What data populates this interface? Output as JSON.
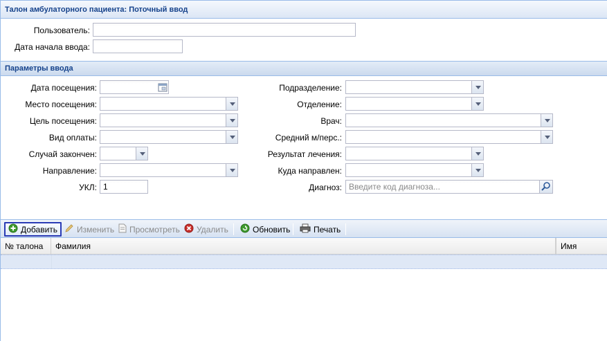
{
  "window": {
    "title": "Талон амбулаторного пациента: Поточный ввод"
  },
  "top_form": {
    "user_label": "Пользователь:",
    "user_value": "",
    "start_date_label": "Дата начала ввода:",
    "start_date_value": ""
  },
  "params": {
    "section_title": "Параметры ввода",
    "visit_date_label": "Дата посещения:",
    "visit_place_label": "Место посещения:",
    "visit_goal_label": "Цель посещения:",
    "payment_type_label": "Вид оплаты:",
    "case_closed_label": "Случай закончен:",
    "direction_label": "Направление:",
    "ukl_label": "УКЛ:",
    "ukl_value": "1",
    "division_label": "Подразделение:",
    "department_label": "Отделение:",
    "doctor_label": "Врач:",
    "nurse_label": "Средний м/перс.:",
    "result_label": "Результат лечения:",
    "referred_to_label": "Куда направлен:",
    "diagnosis_label": "Диагноз:",
    "diagnosis_placeholder": "Введите код диагноза..."
  },
  "toolbar": {
    "add": "Добавить",
    "edit": "Изменить",
    "view": "Просмотреть",
    "delete": "Удалить",
    "refresh": "Обновить",
    "print": "Печать"
  },
  "grid": {
    "columns": [
      "№ талона",
      "Фамилия",
      "Имя"
    ]
  },
  "colors": {
    "header_text": "#15428b",
    "border": "#99bbe8",
    "focus": "#2a3bb5"
  }
}
